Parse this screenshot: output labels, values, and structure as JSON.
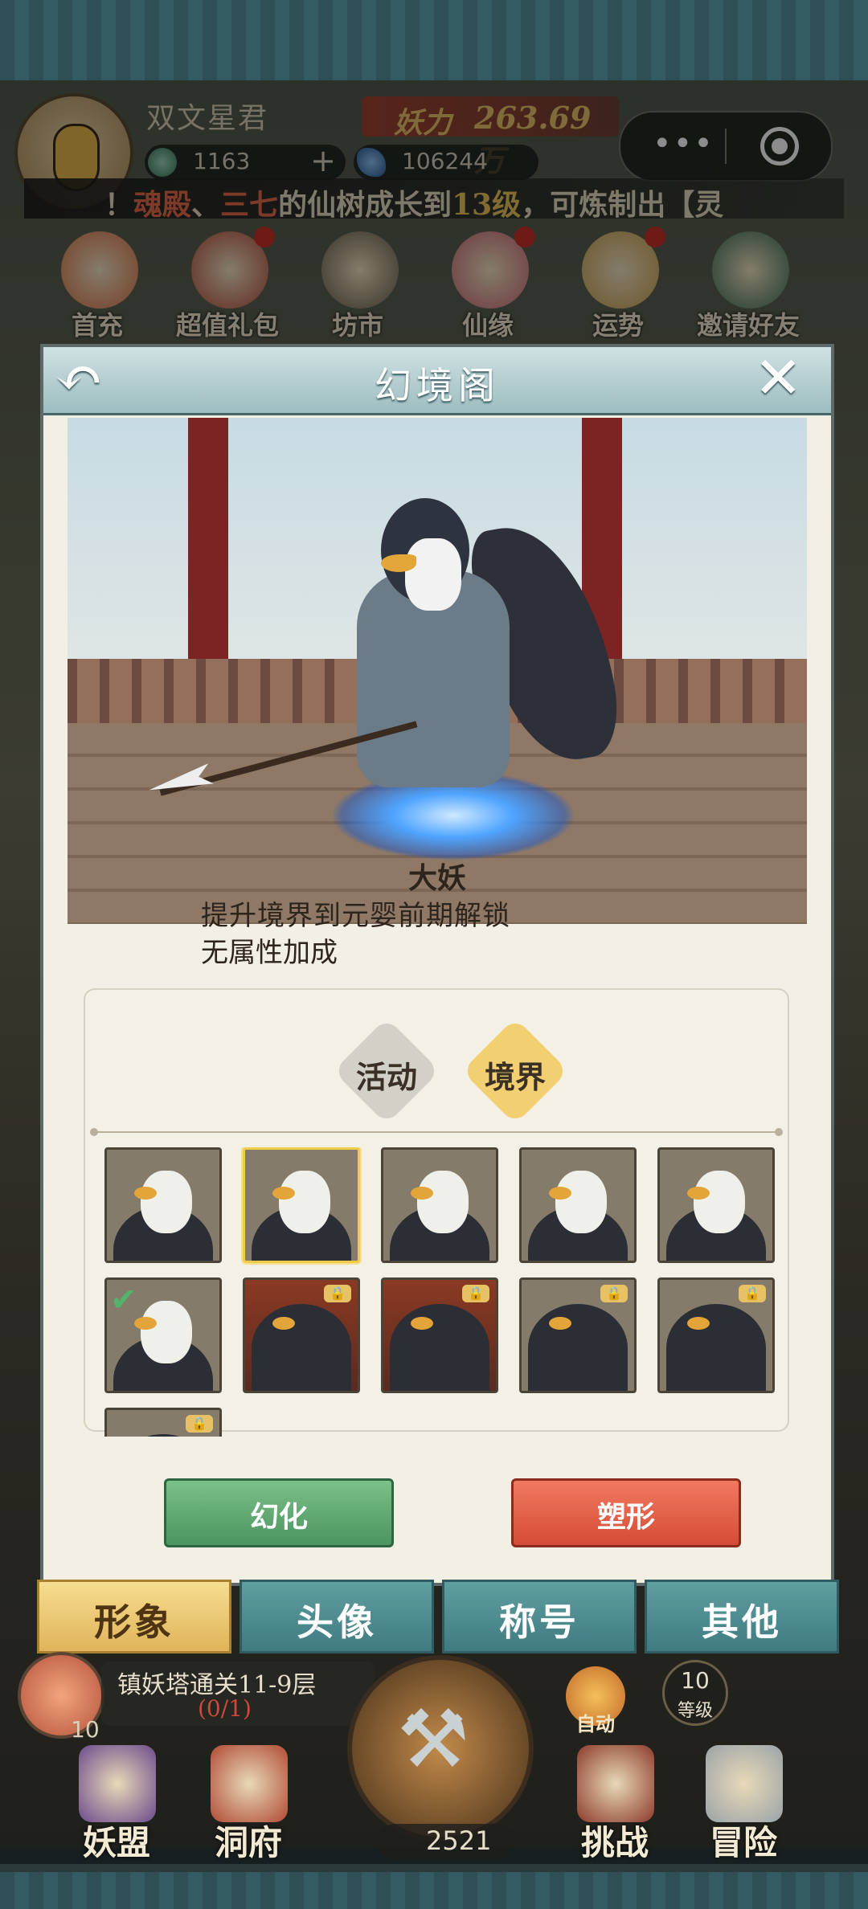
{
  "header": {
    "player_name": "双文星君",
    "power_label": "妖力",
    "power_value": "263.69万",
    "jade_amount": "1163",
    "jade_plus": "+",
    "gem_amount": "106244",
    "mini_menu_dots": "•••",
    "ticker": {
      "prefix": "！",
      "name1": "魂殿",
      "sep": "、",
      "name2": "三七",
      "middle": "的仙树成长到",
      "level": "13级",
      "suffix": "，可炼制出【灵"
    }
  },
  "features": [
    {
      "label": "首充",
      "icon": "first-recharge-icon",
      "color": "#d9734a",
      "badge": false
    },
    {
      "label": "超值礼包",
      "icon": "gift-bag-icon",
      "color": "#b2503c",
      "badge": true
    },
    {
      "label": "坊市",
      "icon": "coin-market-icon",
      "color": "#6a6050",
      "badge": false
    },
    {
      "label": "仙缘",
      "icon": "lotus-icon",
      "color": "#c96a78",
      "badge": true
    },
    {
      "label": "运势",
      "icon": "fortune-icon",
      "color": "#c9a050",
      "badge": true
    },
    {
      "label": "邀请好友",
      "icon": "invite-book-icon",
      "color": "#3c6e58",
      "badge": false
    }
  ],
  "modal": {
    "title": "幻境阁",
    "back_icon": "back-arrow-icon",
    "close_icon": "close-icon",
    "back_glyph": "↶",
    "close_glyph": "✕",
    "character": {
      "name": "大妖",
      "unlock_requirement": "提升境界到元婴前期解锁",
      "attribute_bonus": "无属性加成"
    },
    "category_tabs": [
      {
        "label": "活动",
        "active": false
      },
      {
        "label": "境界",
        "active": true
      }
    ],
    "skins": [
      {
        "variant": "armored",
        "selected": false,
        "equipped": false,
        "locked": false
      },
      {
        "variant": "armored",
        "selected": true,
        "equipped": false,
        "locked": false
      },
      {
        "variant": "white",
        "selected": false,
        "equipped": false,
        "locked": false
      },
      {
        "variant": "white",
        "selected": false,
        "equipped": false,
        "locked": false
      },
      {
        "variant": "white",
        "selected": false,
        "equipped": false,
        "locked": false
      },
      {
        "variant": "white",
        "selected": false,
        "equipped": true,
        "locked": false
      },
      {
        "variant": "dark-red",
        "selected": false,
        "equipped": false,
        "locked": true
      },
      {
        "variant": "dark-red",
        "selected": false,
        "equipped": false,
        "locked": true
      },
      {
        "variant": "dark",
        "selected": false,
        "equipped": false,
        "locked": true
      },
      {
        "variant": "dark",
        "selected": false,
        "equipped": false,
        "locked": true
      },
      {
        "variant": "dark",
        "selected": false,
        "equipped": false,
        "locked": true
      }
    ],
    "buttons": {
      "transform": "幻化",
      "reshape": "塑形"
    }
  },
  "bottom_tabs": [
    {
      "label": "形象",
      "active": true
    },
    {
      "label": "头像",
      "active": false
    },
    {
      "label": "称号",
      "active": false
    },
    {
      "label": "其他",
      "active": false
    }
  ],
  "hud": {
    "quest_text": "镇妖塔通关11-9层",
    "quest_progress": "(0/1)",
    "peach_count": "10",
    "gold_amount": "2521",
    "auto_label": "自动",
    "level_number": "10",
    "level_label": "等级",
    "nav": [
      {
        "label": "妖盟",
        "icon": "alliance-icon"
      },
      {
        "label": "洞府",
        "icon": "cave-residence-icon"
      },
      {
        "label": "挑战",
        "icon": "challenge-icon"
      },
      {
        "label": "冒险",
        "icon": "adventure-icon"
      }
    ]
  },
  "colors": {
    "accent_gold": "#e8c26a",
    "button_green": "#4c9460",
    "button_red": "#d64b36",
    "tab_teal": "#3f7b80",
    "tab_active": "#e0b45a"
  }
}
